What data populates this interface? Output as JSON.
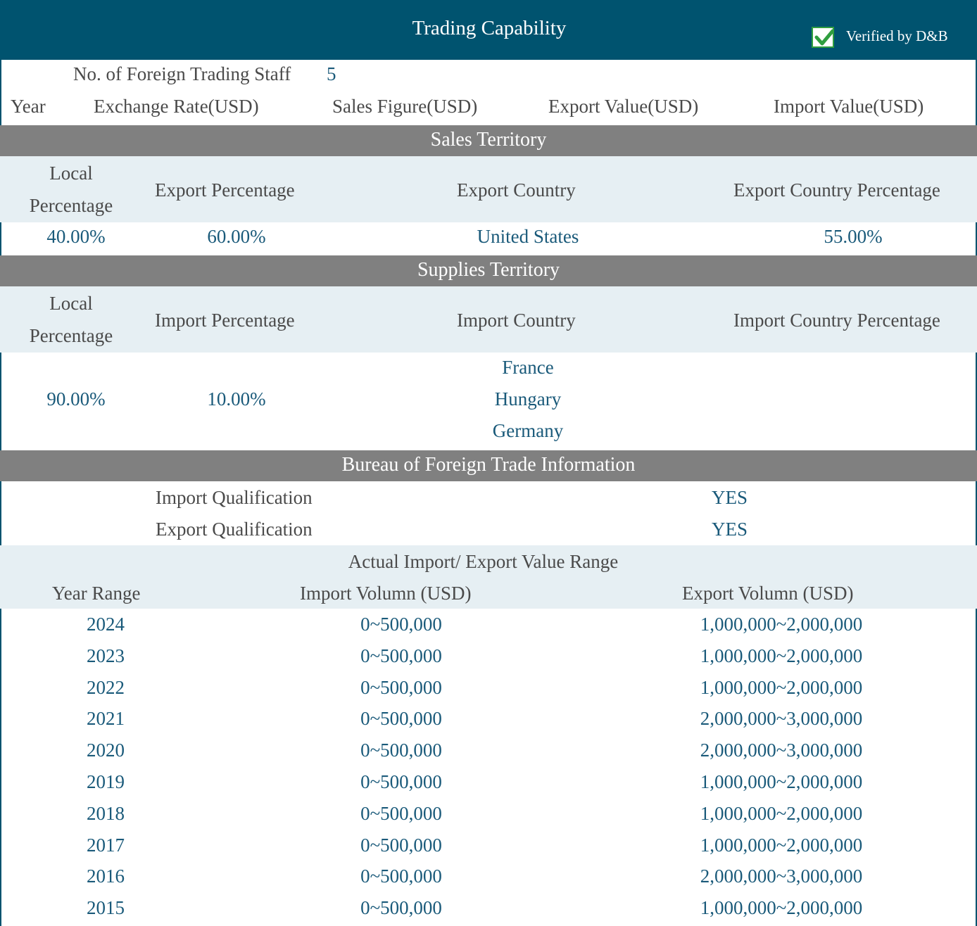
{
  "header": {
    "title": "Trading Capability",
    "verified_label": "Verified by D&B",
    "verified_icon": "checkbox-checked-icon",
    "accent_color": "#00536f"
  },
  "staff": {
    "label": "No. of Foreign Trading Staff",
    "value": "5"
  },
  "financial_columns": [
    "Year",
    "Exchange Rate(USD)",
    "Sales Figure(USD)",
    "Export Value(USD)",
    "Import Value(USD)"
  ],
  "sales_territory": {
    "title": "Sales Territory",
    "headers": {
      "local_line1": "Local",
      "local_line2": "Percentage",
      "export_percentage": "Export Percentage",
      "export_country": "Export Country",
      "export_country_percentage": "Export Country Percentage"
    },
    "row": {
      "local": "40.00%",
      "export": "60.00%",
      "country": "United States",
      "country_percentage": "55.00%"
    }
  },
  "supplies_territory": {
    "title": "Supplies Territory",
    "headers": {
      "local_line1": "Local",
      "local_line2": "Percentage",
      "import_percentage": "Import Percentage",
      "import_country": "Import Country",
      "import_country_percentage": "Import Country Percentage"
    },
    "row": {
      "local": "90.00%",
      "import": "10.00%",
      "countries": [
        "France",
        "Hungary",
        "Germany"
      ]
    }
  },
  "bureau": {
    "title": "Bureau of Foreign Trade Information",
    "import_label": "Import Qualification",
    "import_value": "YES",
    "export_label": "Export Qualification",
    "export_value": "YES"
  },
  "value_range": {
    "title": "Actual Import/ Export Value Range",
    "columns": [
      "Year Range",
      "Import Volumn (USD)",
      "Export Volumn (USD)"
    ],
    "rows": [
      {
        "year": "2024",
        "import": "0~500,000",
        "export": "1,000,000~2,000,000"
      },
      {
        "year": "2023",
        "import": "0~500,000",
        "export": "1,000,000~2,000,000"
      },
      {
        "year": "2022",
        "import": "0~500,000",
        "export": "1,000,000~2,000,000"
      },
      {
        "year": "2021",
        "import": "0~500,000",
        "export": "2,000,000~3,000,000"
      },
      {
        "year": "2020",
        "import": "0~500,000",
        "export": "2,000,000~3,000,000"
      },
      {
        "year": "2019",
        "import": "0~500,000",
        "export": "1,000,000~2,000,000"
      },
      {
        "year": "2018",
        "import": "0~500,000",
        "export": "1,000,000~2,000,000"
      },
      {
        "year": "2017",
        "import": "0~500,000",
        "export": "1,000,000~2,000,000"
      },
      {
        "year": "2016",
        "import": "0~500,000",
        "export": "2,000,000~3,000,000"
      },
      {
        "year": "2015",
        "import": "0~500,000",
        "export": "1,000,000~2,000,000"
      }
    ]
  }
}
